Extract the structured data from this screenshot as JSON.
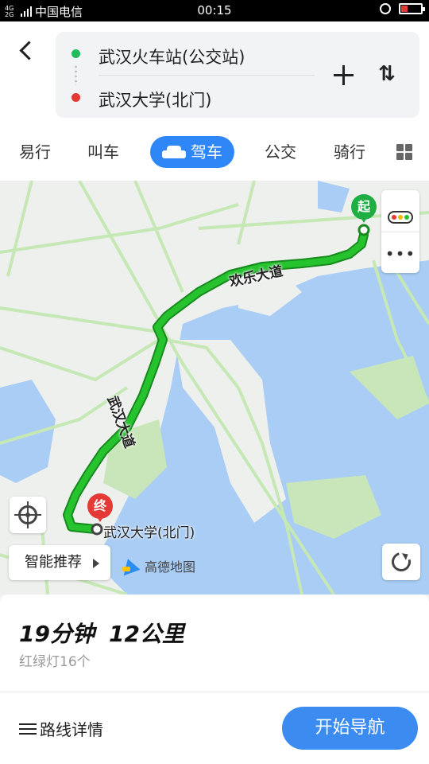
{
  "status_bar": {
    "signal_top": "4G",
    "signal_bottom": "2G",
    "carrier": "中国电信",
    "time": "00:15"
  },
  "header": {
    "origin": "武汉火车站(公交站)",
    "destination": "武汉大学(北门)",
    "modes": [
      "易行",
      "叫车",
      "驾车",
      "公交",
      "骑行"
    ],
    "active_mode": "驾车",
    "swap_symbol": "⇅"
  },
  "map": {
    "start_pin": "起",
    "end_pin": "终",
    "road_labels": [
      "欢乐大道",
      "武汉大道"
    ],
    "destination_label": "武汉大学(北门)",
    "smart_recommend": "智能推荐",
    "brand": "高德地图",
    "more_symbol": "•••",
    "colors": {
      "route": "#1aa922",
      "water": "#a9cdf4",
      "green": "#c8e6b9",
      "road": "#d6eec9"
    }
  },
  "summary": {
    "duration": "19分钟",
    "distance": "12公里",
    "traffic_lights": "红绿灯16个"
  },
  "actions": {
    "route_details": "路线详情",
    "start_navigation": "开始导航"
  }
}
